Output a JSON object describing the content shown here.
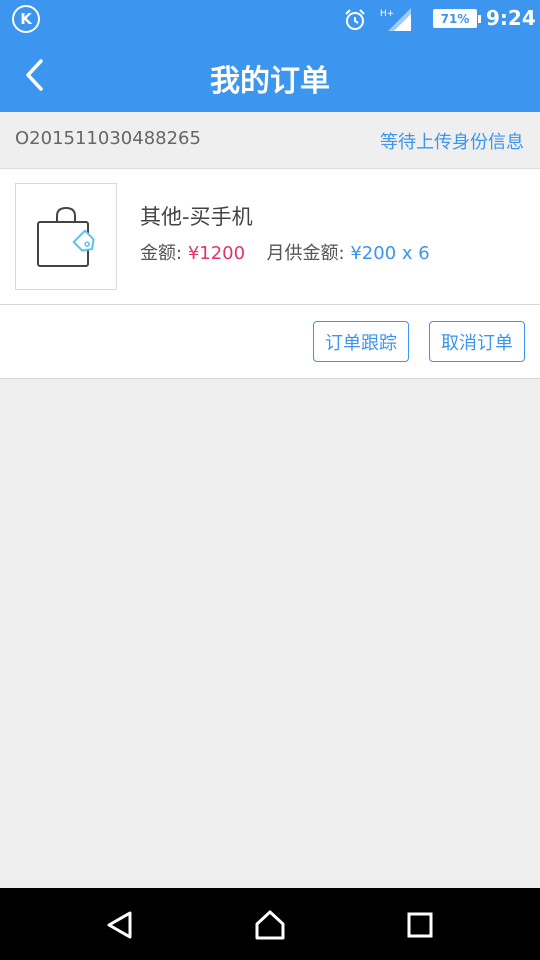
{
  "status_bar": {
    "app_logo": "K",
    "network": "H+",
    "battery": "71%",
    "time": "9:24"
  },
  "header": {
    "title": "我的订单"
  },
  "order": {
    "number": "O201511030488265",
    "status": "等待上传身份信息",
    "product_name": "其他-买手机",
    "amount_label": "金额:",
    "amount_value": "¥1200",
    "monthly_label": "月供金额:",
    "monthly_value": "¥200 x 6"
  },
  "actions": {
    "track_label": "订单跟踪",
    "cancel_label": "取消订单"
  },
  "colors": {
    "primary": "#3c95ee",
    "amount": "#e2336b",
    "background": "#efefef"
  },
  "icons": {
    "back": "chevron-left-icon",
    "thumbnail": "shopping-bag-tag-icon",
    "nav_back": "triangle-back-icon",
    "nav_home": "home-icon",
    "nav_recent": "square-recent-icon"
  }
}
